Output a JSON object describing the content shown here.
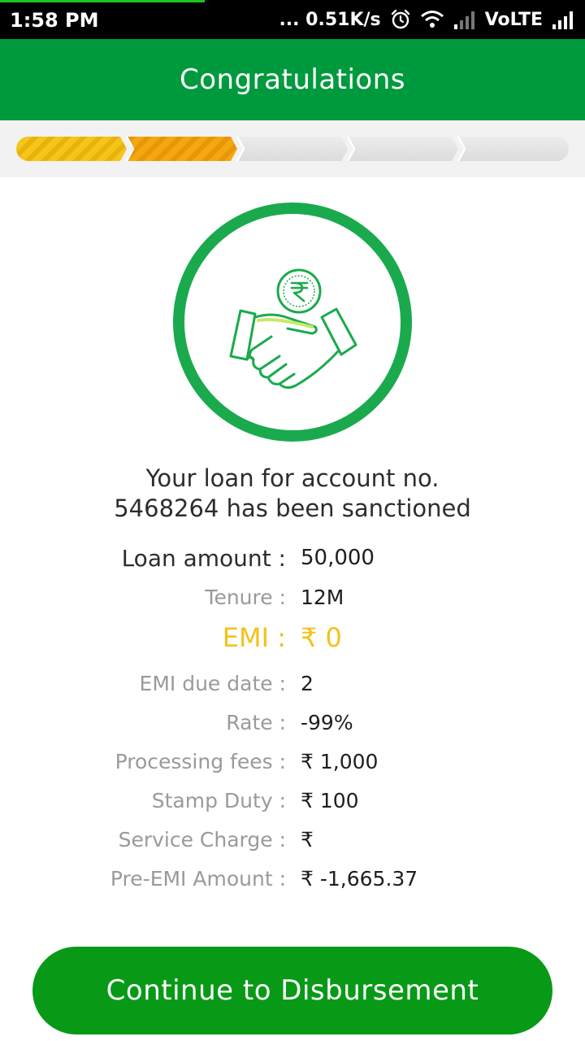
{
  "status_bar": {
    "time": "1:58 PM",
    "net_speed": "... 0.51K/s",
    "carrier": "VoLTE",
    "icons": [
      "alarm-clock-icon",
      "wifi-icon",
      "signal-weak-icon",
      "signal-strong-icon"
    ]
  },
  "header": {
    "title": "Congratulations"
  },
  "progress": {
    "total_steps": 5,
    "completed_steps": 2,
    "colors": {
      "step1": "#f5c518",
      "step2": "#f5a712",
      "pending": "#e3e3e3"
    }
  },
  "illustration": {
    "icon": "handshake-rupee-icon",
    "ring_color": "#1aaa4d"
  },
  "message": {
    "line1": "Your loan for account no.",
    "line2": "5468264 has been sanctioned"
  },
  "details": [
    {
      "label": "Loan amount :",
      "value": "50,000"
    },
    {
      "label": "Tenure :",
      "value": "12M"
    },
    {
      "label": "EMI :",
      "value": "₹ 0"
    },
    {
      "label": "EMI due date :",
      "value": "2"
    },
    {
      "label": "Rate :",
      "value": "-99%"
    },
    {
      "label": "Processing fees :",
      "value": "₹ 1,000"
    },
    {
      "label": "Stamp Duty :",
      "value": "₹ 100"
    },
    {
      "label": "Service Charge :",
      "value": "₹"
    },
    {
      "label": "Pre-EMI Amount :",
      "value": "₹ -1,665.37"
    }
  ],
  "cta": {
    "label": "Continue to Disbursement"
  },
  "colors": {
    "brand_green": "#009a3e",
    "button_green": "#089a17",
    "emi_highlight": "#f3c21a"
  }
}
